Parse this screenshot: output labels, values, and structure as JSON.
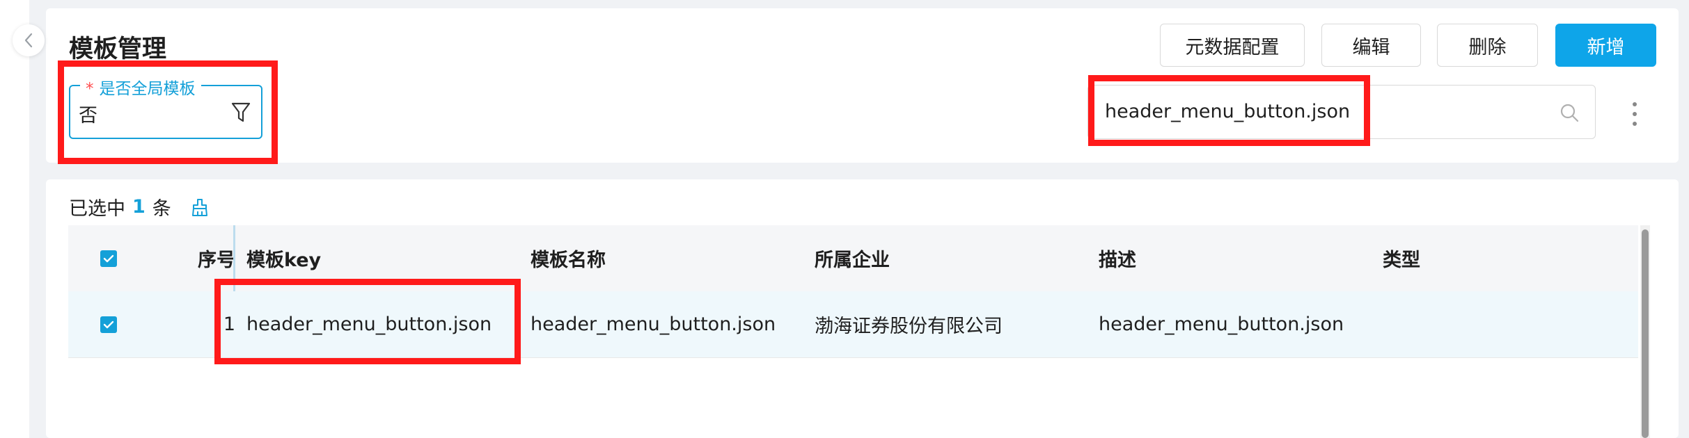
{
  "page": {
    "title": "模板管理"
  },
  "toolbar": {
    "metadata_config": "元数据配置",
    "edit": "编辑",
    "delete": "删除",
    "add": "新增"
  },
  "filter": {
    "required_mark": "*",
    "label": "是否全局模板",
    "value": "否"
  },
  "search": {
    "value": "header_menu_button.json"
  },
  "selection": {
    "prefix": "已选中",
    "count": "1",
    "suffix": "条"
  },
  "table": {
    "columns": {
      "index": "序号",
      "key": "模板key",
      "name": "模板名称",
      "company": "所属企业",
      "description": "描述",
      "type": "类型"
    },
    "rows": [
      {
        "checked": true,
        "index": "1",
        "key": "header_menu_button.json",
        "name": "header_menu_button.json",
        "company": "渤海证券股份有限公司",
        "description": "header_menu_button.json",
        "type": ""
      }
    ]
  },
  "colors": {
    "accent": "#14a0d8",
    "primary_button": "#0ea5e9",
    "highlight_box": "#ff1a1a",
    "required": "#ff4d4f"
  }
}
